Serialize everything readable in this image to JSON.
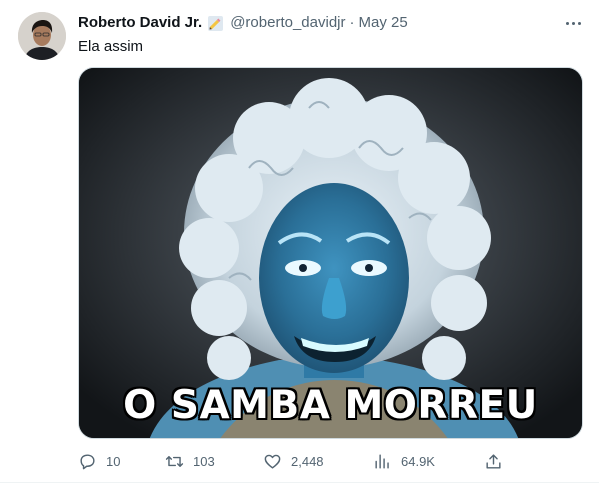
{
  "tweet": {
    "author_name": "Roberto David Jr.",
    "handle": "@roberto_davidjr",
    "separator": "·",
    "date": "May 25",
    "text": "Ela assim",
    "media_caption": "O SAMBA MORREU"
  },
  "actions": {
    "replies": "10",
    "retweets": "103",
    "likes": "2,448",
    "views": "64.9K"
  },
  "colors": {
    "text_primary": "#0f1419",
    "text_secondary": "#536471",
    "border": "#cfd9de"
  },
  "icons": [
    "more-icon",
    "pencil-emoji-icon",
    "reply-icon",
    "retweet-icon",
    "like-icon",
    "views-icon",
    "share-icon"
  ]
}
